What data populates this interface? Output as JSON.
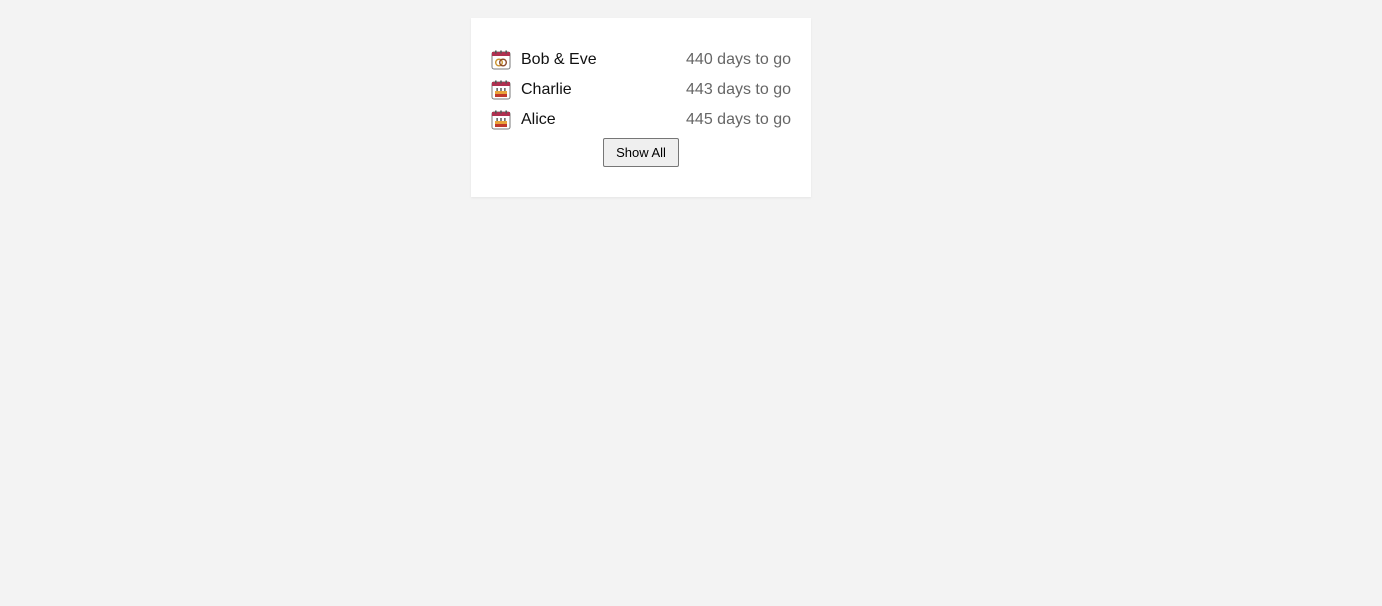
{
  "events": [
    {
      "icon": "wedding-rings-calendar-icon",
      "name": "Bob & Eve",
      "countdown": "440 days to go"
    },
    {
      "icon": "birthday-cake-calendar-icon",
      "name": "Charlie",
      "countdown": "443 days to go"
    },
    {
      "icon": "birthday-cake-calendar-icon",
      "name": "Alice",
      "countdown": "445 days to go"
    }
  ],
  "show_all_label": "Show All",
  "colors": {
    "page_background": "#f3f3f3",
    "card_background": "#ffffff",
    "name_text": "#111111",
    "countdown_text": "#666666",
    "calendar_header": "#b03050",
    "button_background": "#efefef"
  }
}
